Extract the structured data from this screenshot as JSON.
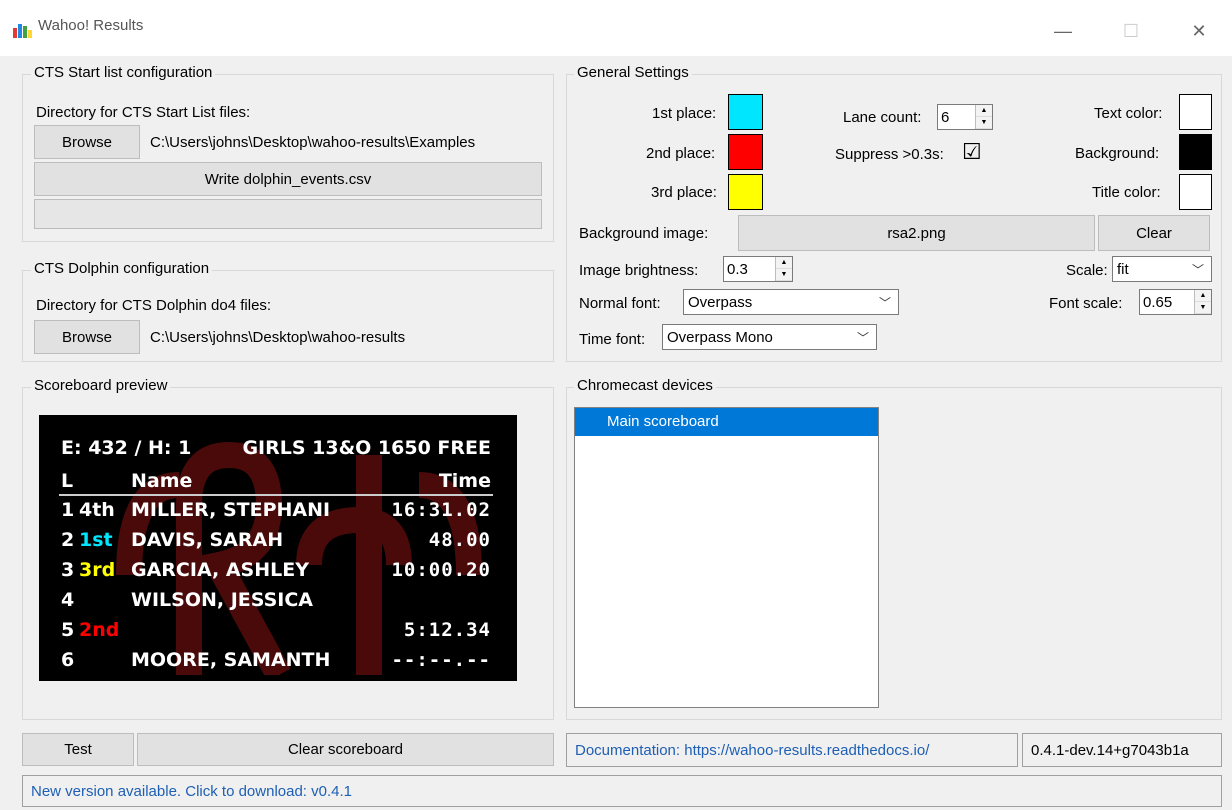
{
  "window": {
    "title": "Wahoo! Results",
    "minimize": "—",
    "maximize": "☐",
    "close": "✕"
  },
  "cts_start": {
    "legend": "CTS Start list configuration",
    "dir_label": "Directory for CTS Start List files:",
    "browse": "Browse",
    "path": "C:\\Users\\johns\\Desktop\\wahoo-results\\Examples",
    "write_button": "Write dolphin_events.csv",
    "progress": 0
  },
  "cts_dolphin": {
    "legend": "CTS Dolphin configuration",
    "dir_label": "Directory for CTS Dolphin do4 files:",
    "browse": "Browse",
    "path": "C:\\Users\\johns\\Desktop\\wahoo-results"
  },
  "general": {
    "legend": "General Settings",
    "first_label": "1st place:",
    "first_color": "#00e6ff",
    "second_label": "2nd place:",
    "second_color": "#ff0000",
    "third_label": "3rd place:",
    "third_color": "#ffff00",
    "lane_count_label": "Lane count:",
    "lane_count": "6",
    "suppress_label": "Suppress >0.3s:",
    "suppress_check": "☑",
    "text_color_label": "Text color:",
    "text_color": "#ffffff",
    "background_label": "Background:",
    "background_color": "#000000",
    "title_color_label": "Title color:",
    "title_color": "#ffffff",
    "bg_image_label": "Background image:",
    "bg_image": "rsa2.png",
    "clear": "Clear",
    "brightness_label": "Image brightness:",
    "brightness": "0.3",
    "scale_label": "Scale:",
    "scale": "fit",
    "normal_font_label": "Normal font:",
    "normal_font": "Overpass",
    "font_scale_label": "Font scale:",
    "font_scale": "0.65",
    "time_font_label": "Time font:",
    "time_font": "Overpass Mono"
  },
  "preview": {
    "legend": "Scoreboard preview",
    "header_left": "E: 432 / H: 1",
    "header_right": "GIRLS 13&O 1650 FREE",
    "col_lane": "L",
    "col_name": "Name",
    "col_time": "Time",
    "rows": [
      {
        "lane": "1",
        "place": "4th",
        "name": "MILLER, STEPHANI",
        "time": "16:31.02"
      },
      {
        "lane": "2",
        "place": "1st",
        "name": "DAVIS, SARAH",
        "time": "48.00"
      },
      {
        "lane": "3",
        "place": "3rd",
        "name": "GARCIA, ASHLEY",
        "time": "10:00.20"
      },
      {
        "lane": "4",
        "place": "",
        "name": "WILSON, JESSICA",
        "time": ""
      },
      {
        "lane": "5",
        "place": "2nd",
        "name": "",
        "time": "5:12.34"
      },
      {
        "lane": "6",
        "place": "",
        "name": "MOORE, SAMANTH",
        "time": "--:--.--"
      }
    ]
  },
  "chromecast": {
    "legend": "Chromecast devices",
    "devices": [
      "Main scoreboard"
    ]
  },
  "bottom": {
    "test": "Test",
    "clear_scoreboard": "Clear scoreboard",
    "docs": "Documentation: https://wahoo-results.readthedocs.io/",
    "version": "0.4.1-dev.14+g7043b1a",
    "status": "New version available. Click to download: v0.4.1"
  }
}
